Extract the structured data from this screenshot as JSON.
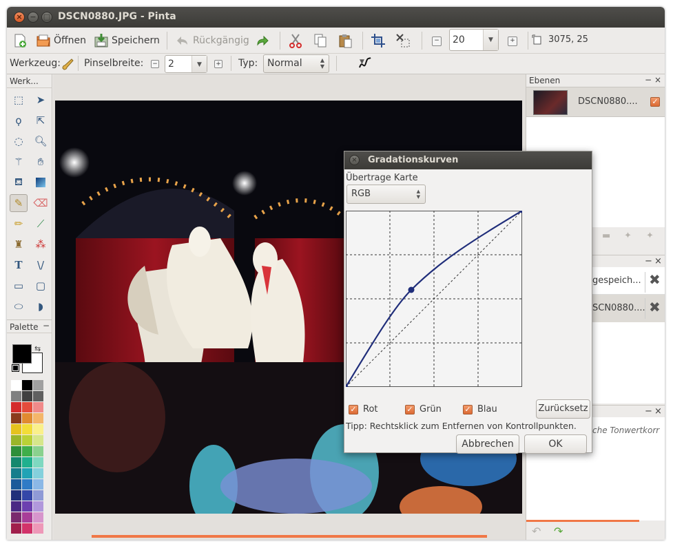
{
  "window": {
    "title": "DSCN0880.JPG - Pinta"
  },
  "toolbar": {
    "open_label": "Öffnen",
    "save_label": "Speichern",
    "undo_label": "Rückgängig",
    "zoom_value": "20",
    "image_size": "3075, 25"
  },
  "toolbar2": {
    "tool_label": "Werkzeug:",
    "brush_width_label": "Pinselbreite:",
    "brush_width_value": "2",
    "type_label": "Typ:",
    "type_value": "Normal"
  },
  "tools_panel": {
    "title": "Werk..."
  },
  "palette_panel": {
    "title": "Palette"
  },
  "palette": {
    "colors": [
      [
        "#ffffff",
        "#000000",
        "#a0a0a0"
      ],
      [
        "#808080",
        "#404040",
        "#606060"
      ],
      [
        "#d42b2b",
        "#e54c3c",
        "#f08a8a"
      ],
      [
        "#8a3b1c",
        "#e08a30",
        "#f4b66a"
      ],
      [
        "#e6c21e",
        "#f2dd38",
        "#faf08a"
      ],
      [
        "#9ab52a",
        "#b9d136",
        "#d6e68a"
      ],
      [
        "#2e8f3a",
        "#3fae4a",
        "#8ad18e"
      ],
      [
        "#14886e",
        "#1fb08e",
        "#7ed8c0"
      ],
      [
        "#167e8c",
        "#21a3b5",
        "#84d0dc"
      ],
      [
        "#1b5a9a",
        "#2f7bc6",
        "#8bb8e6"
      ],
      [
        "#21307a",
        "#3447a8",
        "#8f9ad6"
      ],
      [
        "#4a2a84",
        "#6c40b0",
        "#b198dc"
      ],
      [
        "#7a2a6e",
        "#a83e98",
        "#d795cc"
      ],
      [
        "#a11f4c",
        "#d2336a",
        "#ee98b8"
      ]
    ]
  },
  "layers_panel": {
    "title": "Ebenen",
    "layer_name": "DSCN0880...."
  },
  "history_panel": {
    "items": [
      "gespeich...",
      "SCN0880...."
    ]
  },
  "adjust_panel": {
    "text": "che Tonwertkorr"
  },
  "curves_dialog": {
    "title": "Gradationskurven",
    "map_label": "Übertrage Karte",
    "map_value": "RGB",
    "channels": [
      {
        "label": "Rot",
        "checked": true
      },
      {
        "label": "Grün",
        "checked": true
      },
      {
        "label": "Blau",
        "checked": true
      }
    ],
    "reset_label": "Zurücksetz",
    "tip": "Tipp: Rechtsklick zum Entfernen von Kontrollpunkten.",
    "cancel_label": "Abbrechen",
    "ok_label": "OK"
  },
  "accent_color": "#f07746"
}
